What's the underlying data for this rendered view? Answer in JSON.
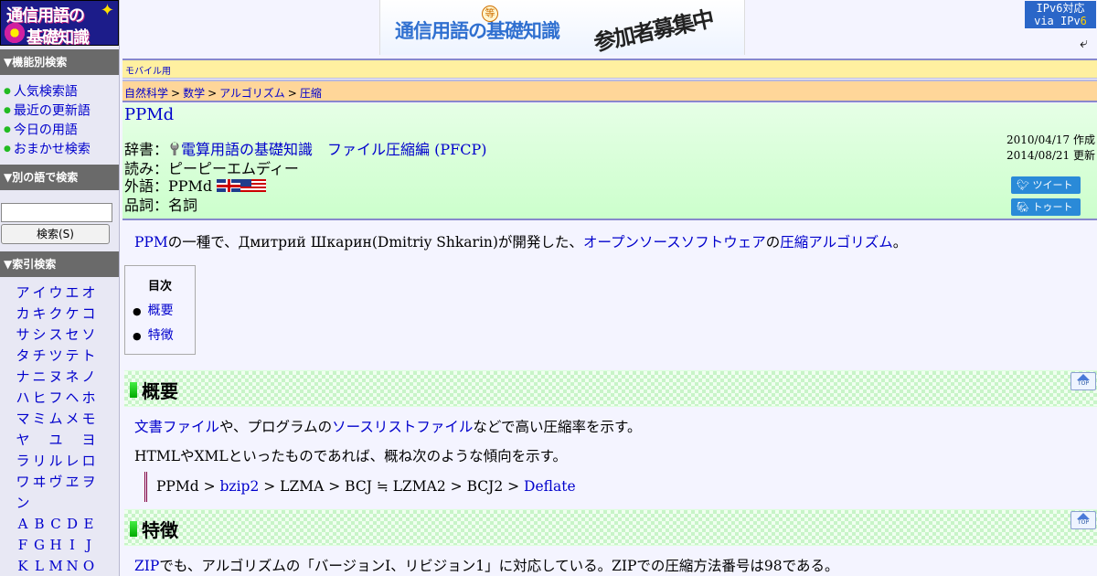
{
  "logo": {
    "line1": "通信用語の",
    "line2": "基礎知識"
  },
  "banner": {
    "title": "通信用語の基礎知識",
    "seal": "等",
    "recruit": "参加者募集中"
  },
  "ipv6": {
    "line1": "IPv6対応",
    "line2_prefix": "via IPv",
    "line2_suffix": "6"
  },
  "sidebar": {
    "feature_search_heading": "▼機能別検索",
    "feature_items": [
      {
        "label": "人気検索語"
      },
      {
        "label": "最近の更新語"
      },
      {
        "label": "今日の用語"
      },
      {
        "label": "おまかせ検索"
      }
    ],
    "other_word_heading": "▼別の語で検索",
    "search_button": "検索(S)",
    "index_heading": "▼索引検索",
    "kana_rows": [
      [
        "ア",
        "イ",
        "ウ",
        "エ",
        "オ"
      ],
      [
        "カ",
        "キ",
        "ク",
        "ケ",
        "コ"
      ],
      [
        "サ",
        "シ",
        "ス",
        "セ",
        "ソ"
      ],
      [
        "タ",
        "チ",
        "ツ",
        "テ",
        "ト"
      ],
      [
        "ナ",
        "ニ",
        "ヌ",
        "ネ",
        "ノ"
      ],
      [
        "ハ",
        "ヒ",
        "フ",
        "ヘ",
        "ホ"
      ],
      [
        "マ",
        "ミ",
        "ム",
        "メ",
        "モ"
      ],
      [
        "ヤ",
        "",
        "ユ",
        "",
        "ヨ"
      ],
      [
        "ラ",
        "リ",
        "ル",
        "レ",
        "ロ"
      ],
      [
        "ワ",
        "ヰ",
        "ヴ",
        "ヱ",
        "ヲ"
      ],
      [
        "ン",
        "",
        "",
        "",
        ""
      ],
      [
        "A",
        "B",
        "C",
        "D",
        "E"
      ],
      [
        "F",
        "G",
        "H",
        "I",
        "J"
      ],
      [
        "K",
        "L",
        "M",
        "N",
        "O"
      ]
    ]
  },
  "mobile_link": "モバイル用",
  "breadcrumb": [
    "自然科学",
    "数学",
    "アルゴリズム",
    "圧縮"
  ],
  "breadcrumb_sep": ">",
  "entry": {
    "title": "PPMd",
    "dict_label": "辞書：",
    "dict_value": "電算用語の基礎知識　ファイル圧縮編 (PFCP)",
    "reading": "読み：ピーピーエムディー",
    "foreign_label": "外語：PPMd",
    "pos": "品詞：名詞",
    "created": "2010/04/17 作成",
    "updated": "2014/08/21 更新",
    "tweet": "ツイート",
    "toot": "トゥート"
  },
  "intro": {
    "link1": "PPM",
    "text1": "の一種で、Дмитрий Шкарин(Dmitriy Shkarin)が開発した、",
    "link2": "オープンソースソフトウェア",
    "text2": "の",
    "link3": "圧縮アルゴリズム",
    "text3": "。"
  },
  "toc": {
    "title": "目次",
    "items": [
      "概要",
      "特徴"
    ]
  },
  "sections": [
    {
      "heading": "概要"
    },
    {
      "heading": "特徴"
    }
  ],
  "overview": {
    "link1": "文書ファイル",
    "text1": "や、プログラムの",
    "link2": "ソースリストファイル",
    "text2": "などで高い圧縮率を示す。",
    "para2": "HTMLやXMLといったものであれば、概ね次のような傾向を示す。",
    "q1": "PPMd > ",
    "q_link1": "bzip2",
    "q2": " > LZMA > BCJ ≒ LZMA2 > BCJ2 > ",
    "q_link2": "Deflate"
  },
  "features": {
    "link1": "ZIP",
    "text1": "でも、アルゴリズムの「バージョンⅠ、リビジョン1」に対応している。ZIPでの圧縮方法番号は98である。"
  },
  "top_button": "TOP"
}
